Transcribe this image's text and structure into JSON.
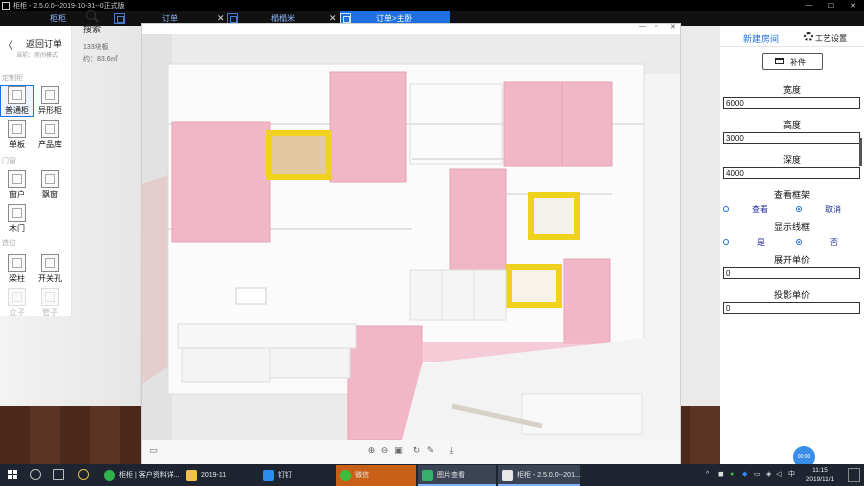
{
  "window": {
    "title": "柜柜 - 2.5.0.0--2019-10-31--0正式版"
  },
  "tabs": [
    {
      "label": "柜柜"
    },
    {
      "label": "订单"
    },
    {
      "label": "榻榻米"
    },
    {
      "label": "订单>主卧"
    }
  ],
  "left_panel": {
    "back_label": "返回订单",
    "subtitle": "当前：房间模式",
    "search_label": "搜索",
    "board_count": "133块板",
    "area": "约：83.6㎡",
    "sections": {
      "custom": "定制柜",
      "doors": "门窗",
      "misc": "造位"
    },
    "tools": [
      {
        "label": "普通柜"
      },
      {
        "label": "异形柜"
      },
      {
        "label": "单板"
      },
      {
        "label": "产品库"
      },
      {
        "label": "窗户"
      },
      {
        "label": "飘窗"
      },
      {
        "label": "木门"
      },
      {
        "label": "梁柱"
      },
      {
        "label": "开关孔"
      },
      {
        "label": "立子"
      },
      {
        "label": "管子"
      }
    ]
  },
  "right_panel": {
    "new_room": "新建房间",
    "craft_settings": "工艺设置",
    "bujian_button": "补件",
    "width_label": "宽度",
    "width_value": "6000",
    "height_label": "高度",
    "height_value": "3000",
    "depth_label": "深度",
    "depth_value": "4000",
    "frame_label": "查看框架",
    "frame_view": "查看",
    "frame_cancel": "取消",
    "wire_label": "显示线框",
    "wire_yes": "是",
    "wire_no": "否",
    "unfold_price_label": "展开单价",
    "unfold_price_value": "0",
    "proj_price_label": "投影单价",
    "proj_price_value": "0"
  },
  "help_bubble": "00:00",
  "taskbar": {
    "items": [
      {
        "label": "柜柜 | 客户资料详..."
      },
      {
        "label": "2019-11"
      },
      {
        "label": "钉钉"
      },
      {
        "label": "微信"
      },
      {
        "label": "图片查看"
      },
      {
        "label": "柜柜 - 2.5.0.0--201..."
      }
    ],
    "ime": "中",
    "time": "11:15",
    "date": "2019/11/1"
  },
  "colors": {
    "accent": "#1e6fe0",
    "cabinet_pink": "#f2b7c7",
    "cabinet_yellow": "#f0d21e",
    "floor": "#4b2a1b"
  }
}
